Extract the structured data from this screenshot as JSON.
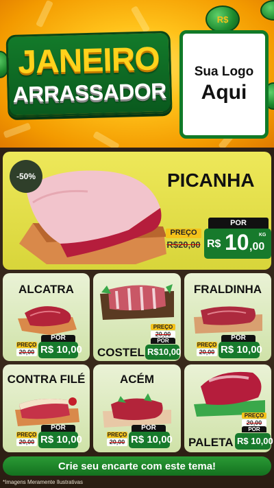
{
  "hero": {
    "title_line1": "JANEIRO",
    "title_line2": "ARRASSADOR",
    "coin_symbol": "R$",
    "logo_line1": "Sua Logo",
    "logo_line2": "Aqui"
  },
  "featured": {
    "discount": "-50%",
    "name": "PICANHA",
    "preco_label": "PREÇO",
    "old_price": "R$20,00",
    "por_label": "POR",
    "price_currency": "R$",
    "price_int": "10",
    "price_cents": ",00",
    "unit": "KG"
  },
  "products": [
    {
      "name": "ALCATRA",
      "preco_label": "PREÇO",
      "old_price": "20,00",
      "por_label": "POR",
      "price": "R$ 10,00",
      "unit": "KG"
    },
    {
      "name": "COSTELA",
      "preco_label": "PREÇO",
      "old_price": "20,00",
      "por_label": "POR",
      "price": "R$10,00",
      "unit": "KG"
    },
    {
      "name": "FRALDINHA",
      "preco_label": "PREÇO",
      "old_price": "20,00",
      "por_label": "POR",
      "price": "R$ 10,00",
      "unit": "KG"
    },
    {
      "name": "CONTRA FILÉ",
      "preco_label": "PREÇO",
      "old_price": "20,00",
      "por_label": "POR",
      "price": "R$ 10,00",
      "unit": "KG"
    },
    {
      "name": "ACÉM",
      "preco_label": "PREÇO",
      "old_price": "20,00",
      "por_label": "POR",
      "price": "R$ 10,00",
      "unit": "KG"
    },
    {
      "name": "PALETA",
      "preco_label": "PREÇO",
      "old_price": "20,00",
      "por_label": "POR",
      "price": "R$ 10,00",
      "unit": "KG"
    }
  ],
  "footer": {
    "cta": "Crie seu encarte com este tema!",
    "disclaimer": "*Imagens Meramente Ilustrativas"
  },
  "colors": {
    "brand_green": "#177a2c",
    "accent_yellow": "#f4c21a",
    "hero_orange": "#f39a00"
  }
}
